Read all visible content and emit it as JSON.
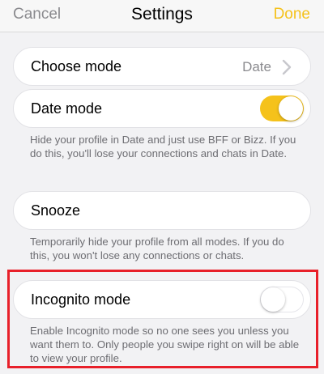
{
  "navbar": {
    "cancel_label": "Cancel",
    "title": "Settings",
    "done_label": "Done"
  },
  "choose_mode": {
    "label": "Choose mode",
    "value": "Date"
  },
  "date_mode": {
    "label": "Date mode",
    "toggle_on": true,
    "description": "Hide your profile in Date and just use BFF or Bizz. If you do this, you'll lose your connections and chats in Date."
  },
  "snooze": {
    "label": "Snooze",
    "description": "Temporarily hide your profile from all modes. If you do this, you won't lose any connections or chats."
  },
  "incognito_mode": {
    "label": "Incognito mode",
    "toggle_on": false,
    "description": "Enable Incognito mode so no one sees you unless you want them to. Only people you swipe right on will be able to view your profile."
  },
  "colors": {
    "accent": "#f5c21b",
    "highlight": "#e8202a",
    "secondary_text": "#6d6d72"
  }
}
